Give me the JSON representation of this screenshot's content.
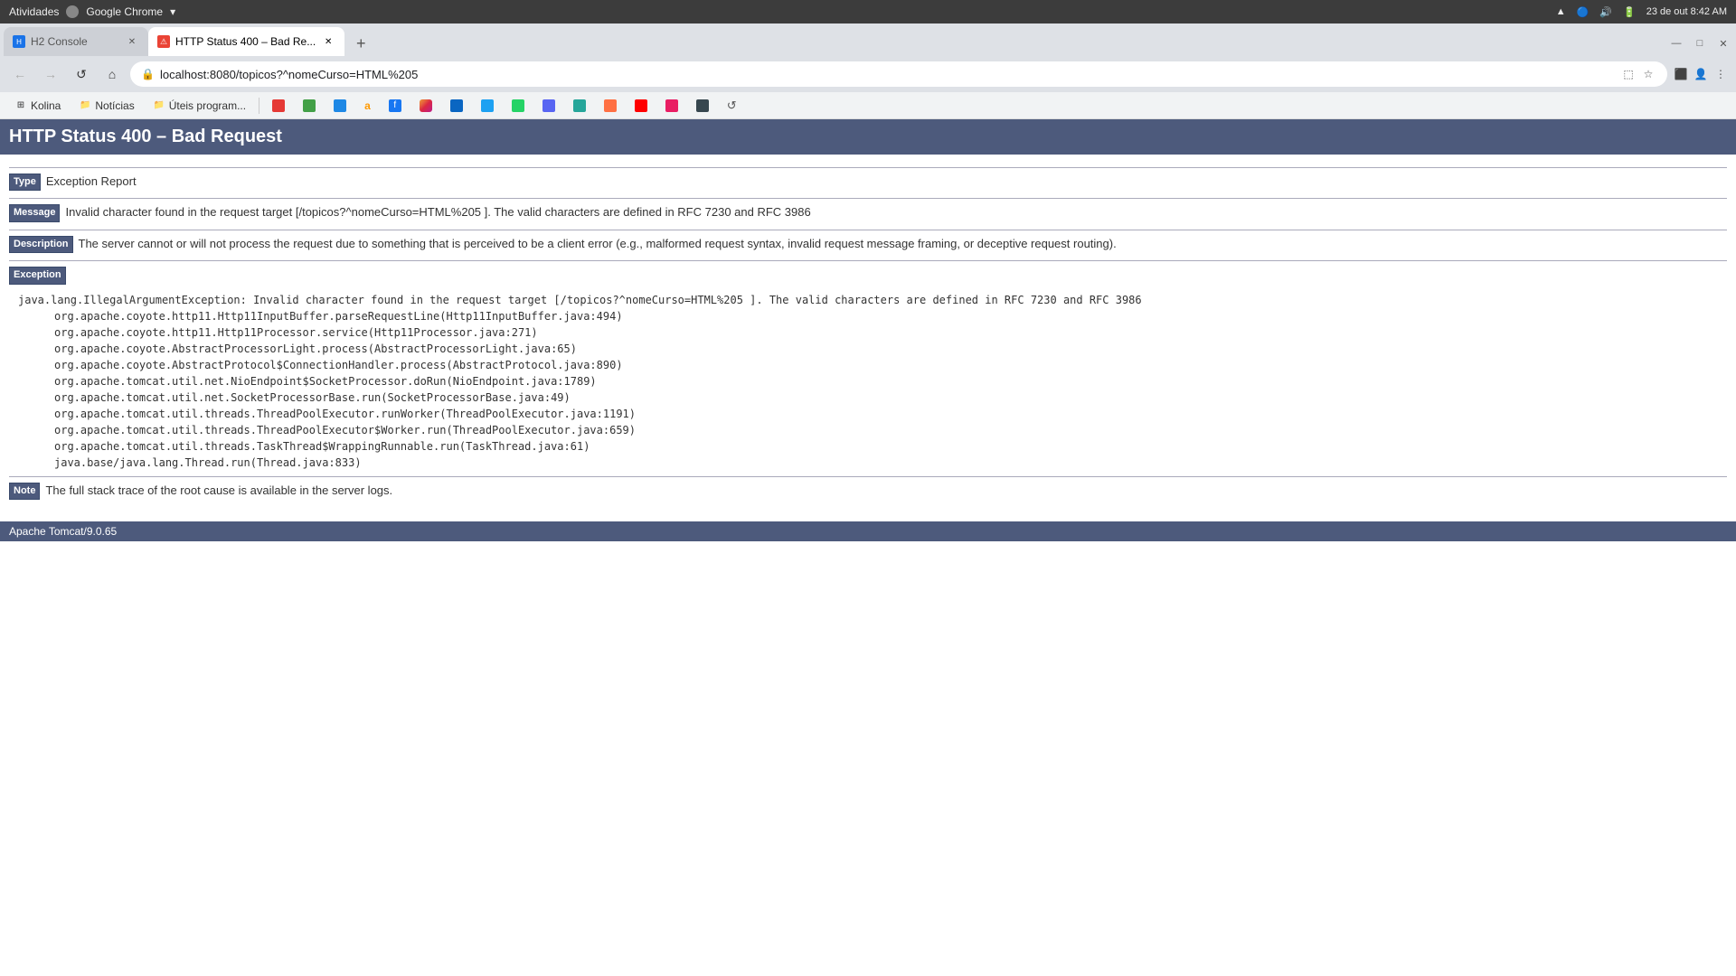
{
  "os": {
    "left_app": "Atividades",
    "browser_label": "Google Chrome",
    "datetime": "23 de out  8:42 AM"
  },
  "tabs": [
    {
      "id": "h2-console",
      "favicon_type": "h2",
      "favicon_text": "H",
      "title": "H2 Console",
      "active": false
    },
    {
      "id": "error-page",
      "favicon_type": "error",
      "favicon_text": "!",
      "title": "HTTP Status 400 – Bad Re...",
      "active": true
    }
  ],
  "address_bar": {
    "url": "localhost:8080/topicos?^nomeCurso=HTML%205"
  },
  "bookmarks": [
    {
      "icon": "▤",
      "label": "Kolina",
      "color": "#888"
    },
    {
      "icon": "📰",
      "label": "Notícias",
      "color": "#888"
    },
    {
      "icon": "⚙",
      "label": "Úteis program...",
      "color": "#888"
    }
  ],
  "page": {
    "title": "HTTP Status 400 – Bad Request",
    "type_label": "Type",
    "type_value": "Exception Report",
    "message_label": "Message",
    "message_value": "Invalid character found in the request target [/topicos?^nomeCurso=HTML%205 ]. The valid characters are defined in RFC 7230 and RFC 3986",
    "description_label": "Description",
    "description_value": "The server cannot or will not process the request due to something that is perceived to be a client error (e.g., malformed request syntax, invalid request message framing, or deceptive request routing).",
    "exception_label": "Exception",
    "stack_trace": [
      "java.lang.IllegalArgumentException: Invalid character found in the request target [/topicos?^nomeCurso=HTML%205 ]. The valid characters are defined in RFC 7230 and RFC 3986",
      "\torg.apache.coyote.http11.Http11InputBuffer.parseRequestLine(Http11InputBuffer.java:494)",
      "\torg.apache.coyote.http11.Http11Processor.service(Http11Processor.java:271)",
      "\torg.apache.coyote.AbstractProcessorLight.process(AbstractProcessorLight.java:65)",
      "\torg.apache.coyote.AbstractProtocol$ConnectionHandler.process(AbstractProtocol.java:890)",
      "\torg.apache.tomcat.util.net.NioEndpoint$SocketProcessor.doRun(NioEndpoint.java:1789)",
      "\torg.apache.tomcat.util.net.SocketProcessorBase.run(SocketProcessorBase.java:49)",
      "\torg.apache.tomcat.util.threads.ThreadPoolExecutor.runWorker(ThreadPoolExecutor.java:1191)",
      "\torg.apache.tomcat.util.threads.ThreadPoolExecutor$Worker.run(ThreadPoolExecutor.java:659)",
      "\torg.apache.tomcat.util.threads.TaskThread$WrappingRunnable.run(TaskThread.java:61)",
      "\tjava.base/java.lang.Thread.run(Thread.java:833)"
    ],
    "note_label": "Note",
    "note_value": "The full stack trace of the root cause is available in the server logs.",
    "footer": "Apache Tomcat/9.0.65"
  }
}
